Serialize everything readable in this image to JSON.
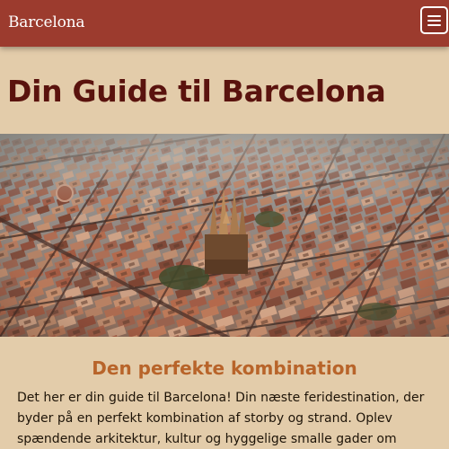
{
  "navbar": {
    "brand": "Barcelona",
    "menu_icon": "hamburger-menu-icon"
  },
  "hero": {
    "title": "Din Guide til Barcelona"
  },
  "image": {
    "subject": "aerial-city-grid-photo"
  },
  "section": {
    "heading": "Den perfekte kombination",
    "paragraph": "Det her er din guide til Barcelona! Din næste feridestination, der byder på en perfekt kombination af storby og strand. Oplev spændende arkitektur, kultur og hyggelige smalle gader om dagen, et hav af"
  },
  "colors": {
    "navbar": "#9c3b2e",
    "page_background": "#e3ccaa",
    "title": "#5a130e",
    "heading_accent": "#b8642a",
    "body_text": "#1e1408"
  }
}
